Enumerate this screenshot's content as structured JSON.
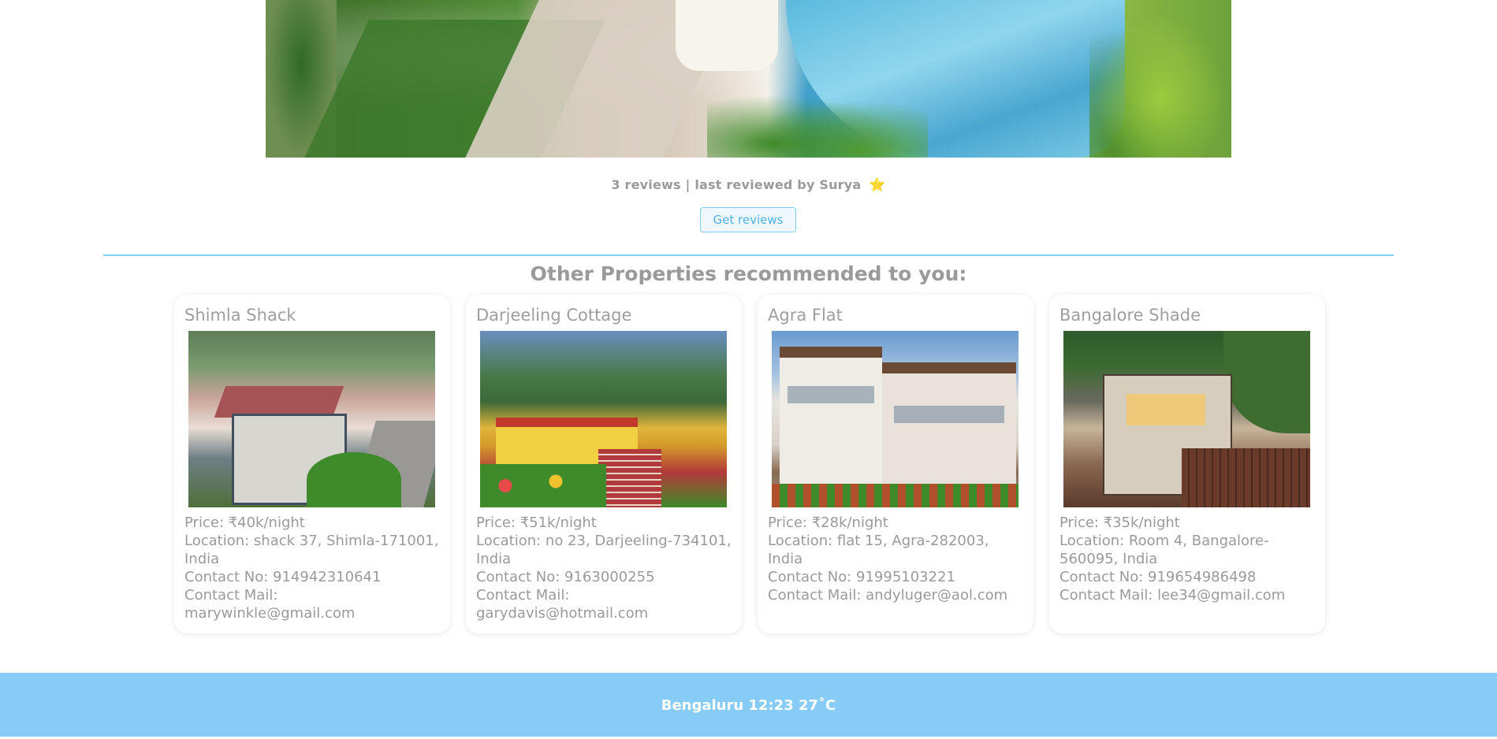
{
  "hero": {
    "image_alt": "property-photo-pool"
  },
  "reviews": {
    "summary": "3 reviews | last reviewed by Surya",
    "star": "⭐",
    "button_label": "Get reviews"
  },
  "recommendations": {
    "title": "Other Properties recommended to you:",
    "cards": [
      {
        "name": "Shimla Shack",
        "price": "Price: ₹40k/night",
        "location": "Location: shack 37, Shimla-171001, India",
        "contact_no": "Contact No: 914942310641",
        "contact_mail": "Contact Mail: marywinkle@gmail.com"
      },
      {
        "name": "Darjeeling Cottage",
        "price": "Price: ₹51k/night",
        "location": "Location: no 23, Darjeeling-734101, India",
        "contact_no": "Contact No: 9163000255",
        "contact_mail": "Contact Mail: garydavis@hotmail.com"
      },
      {
        "name": "Agra Flat",
        "price": "Price: ₹28k/night",
        "location": "Location: flat 15, Agra-282003, India",
        "contact_no": "Contact No: 91995103221",
        "contact_mail": "Contact Mail: andyluger@aol.com"
      },
      {
        "name": "Bangalore Shade",
        "price": "Price: ₹35k/night",
        "location": "Location: Room 4, Bangalore-560095, India",
        "contact_no": "Contact No: 919654986498",
        "contact_mail": "Contact Mail: lee34@gmail.com"
      }
    ]
  },
  "footer": {
    "text": "Bengaluru 12:23 27˚C"
  },
  "colors": {
    "accent": "#4db1e3",
    "divider": "#7fd1ee",
    "footer_bg": "#87cbf7",
    "star": "#f5c518",
    "text": "#9a9a9a"
  }
}
